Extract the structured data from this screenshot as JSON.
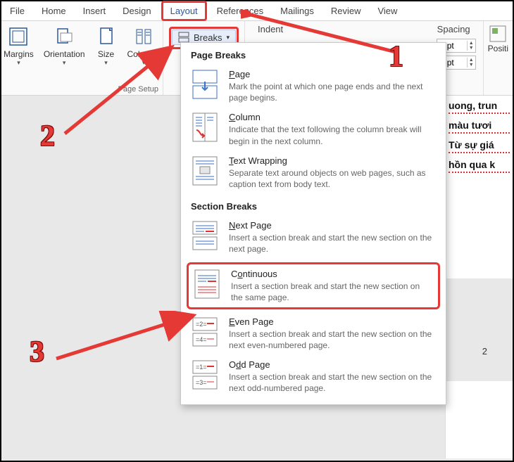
{
  "tabs": [
    "File",
    "Home",
    "Insert",
    "Design",
    "Layout",
    "References",
    "Mailings",
    "Review",
    "View"
  ],
  "ribbon": {
    "margins": "Margins",
    "orientation": "Orientation",
    "size": "Size",
    "columns": "Columns",
    "breaks": "Breaks",
    "page_setup": "Page Setup",
    "indent": "Indent",
    "spacing": "Spacing",
    "spin_before": "0 pt",
    "spin_after": "0 pt",
    "position": "Positi"
  },
  "dropdown": {
    "page_breaks_title": "Page Breaks",
    "section_breaks_title": "Section Breaks",
    "items_page": [
      {
        "title_pre": "",
        "title_u": "P",
        "title_post": "age",
        "desc": "Mark the point at which one page ends and the next page begins."
      },
      {
        "title_pre": "",
        "title_u": "C",
        "title_post": "olumn",
        "desc": "Indicate that the text following the column break will begin in the next column."
      },
      {
        "title_pre": "",
        "title_u": "T",
        "title_post": "ext Wrapping",
        "desc": "Separate text around objects on web pages, such as caption text from body text."
      }
    ],
    "items_section": [
      {
        "title_pre": "",
        "title_u": "N",
        "title_post": "ext Page",
        "desc": "Insert a section break and start the new section on the next page."
      },
      {
        "title_pre": "C",
        "title_u": "o",
        "title_post": "ntinuous",
        "desc": "Insert a section break and start the new section on the same page.",
        "boxed": true
      },
      {
        "title_pre": "",
        "title_u": "E",
        "title_post": "ven Page",
        "desc": "Insert a section break and start the new section on the next even-numbered page."
      },
      {
        "title_pre": "O",
        "title_u": "d",
        "title_post": "d Page",
        "desc": "Insert a section break and start the new section on the next odd-numbered page."
      }
    ]
  },
  "doc": {
    "line2": "màu tươi",
    "line3": "Từ sự giá",
    "line4": "hồn qua k"
  },
  "page_number": "2",
  "annot": {
    "n1": "1",
    "n2": "2",
    "n3": "3"
  }
}
